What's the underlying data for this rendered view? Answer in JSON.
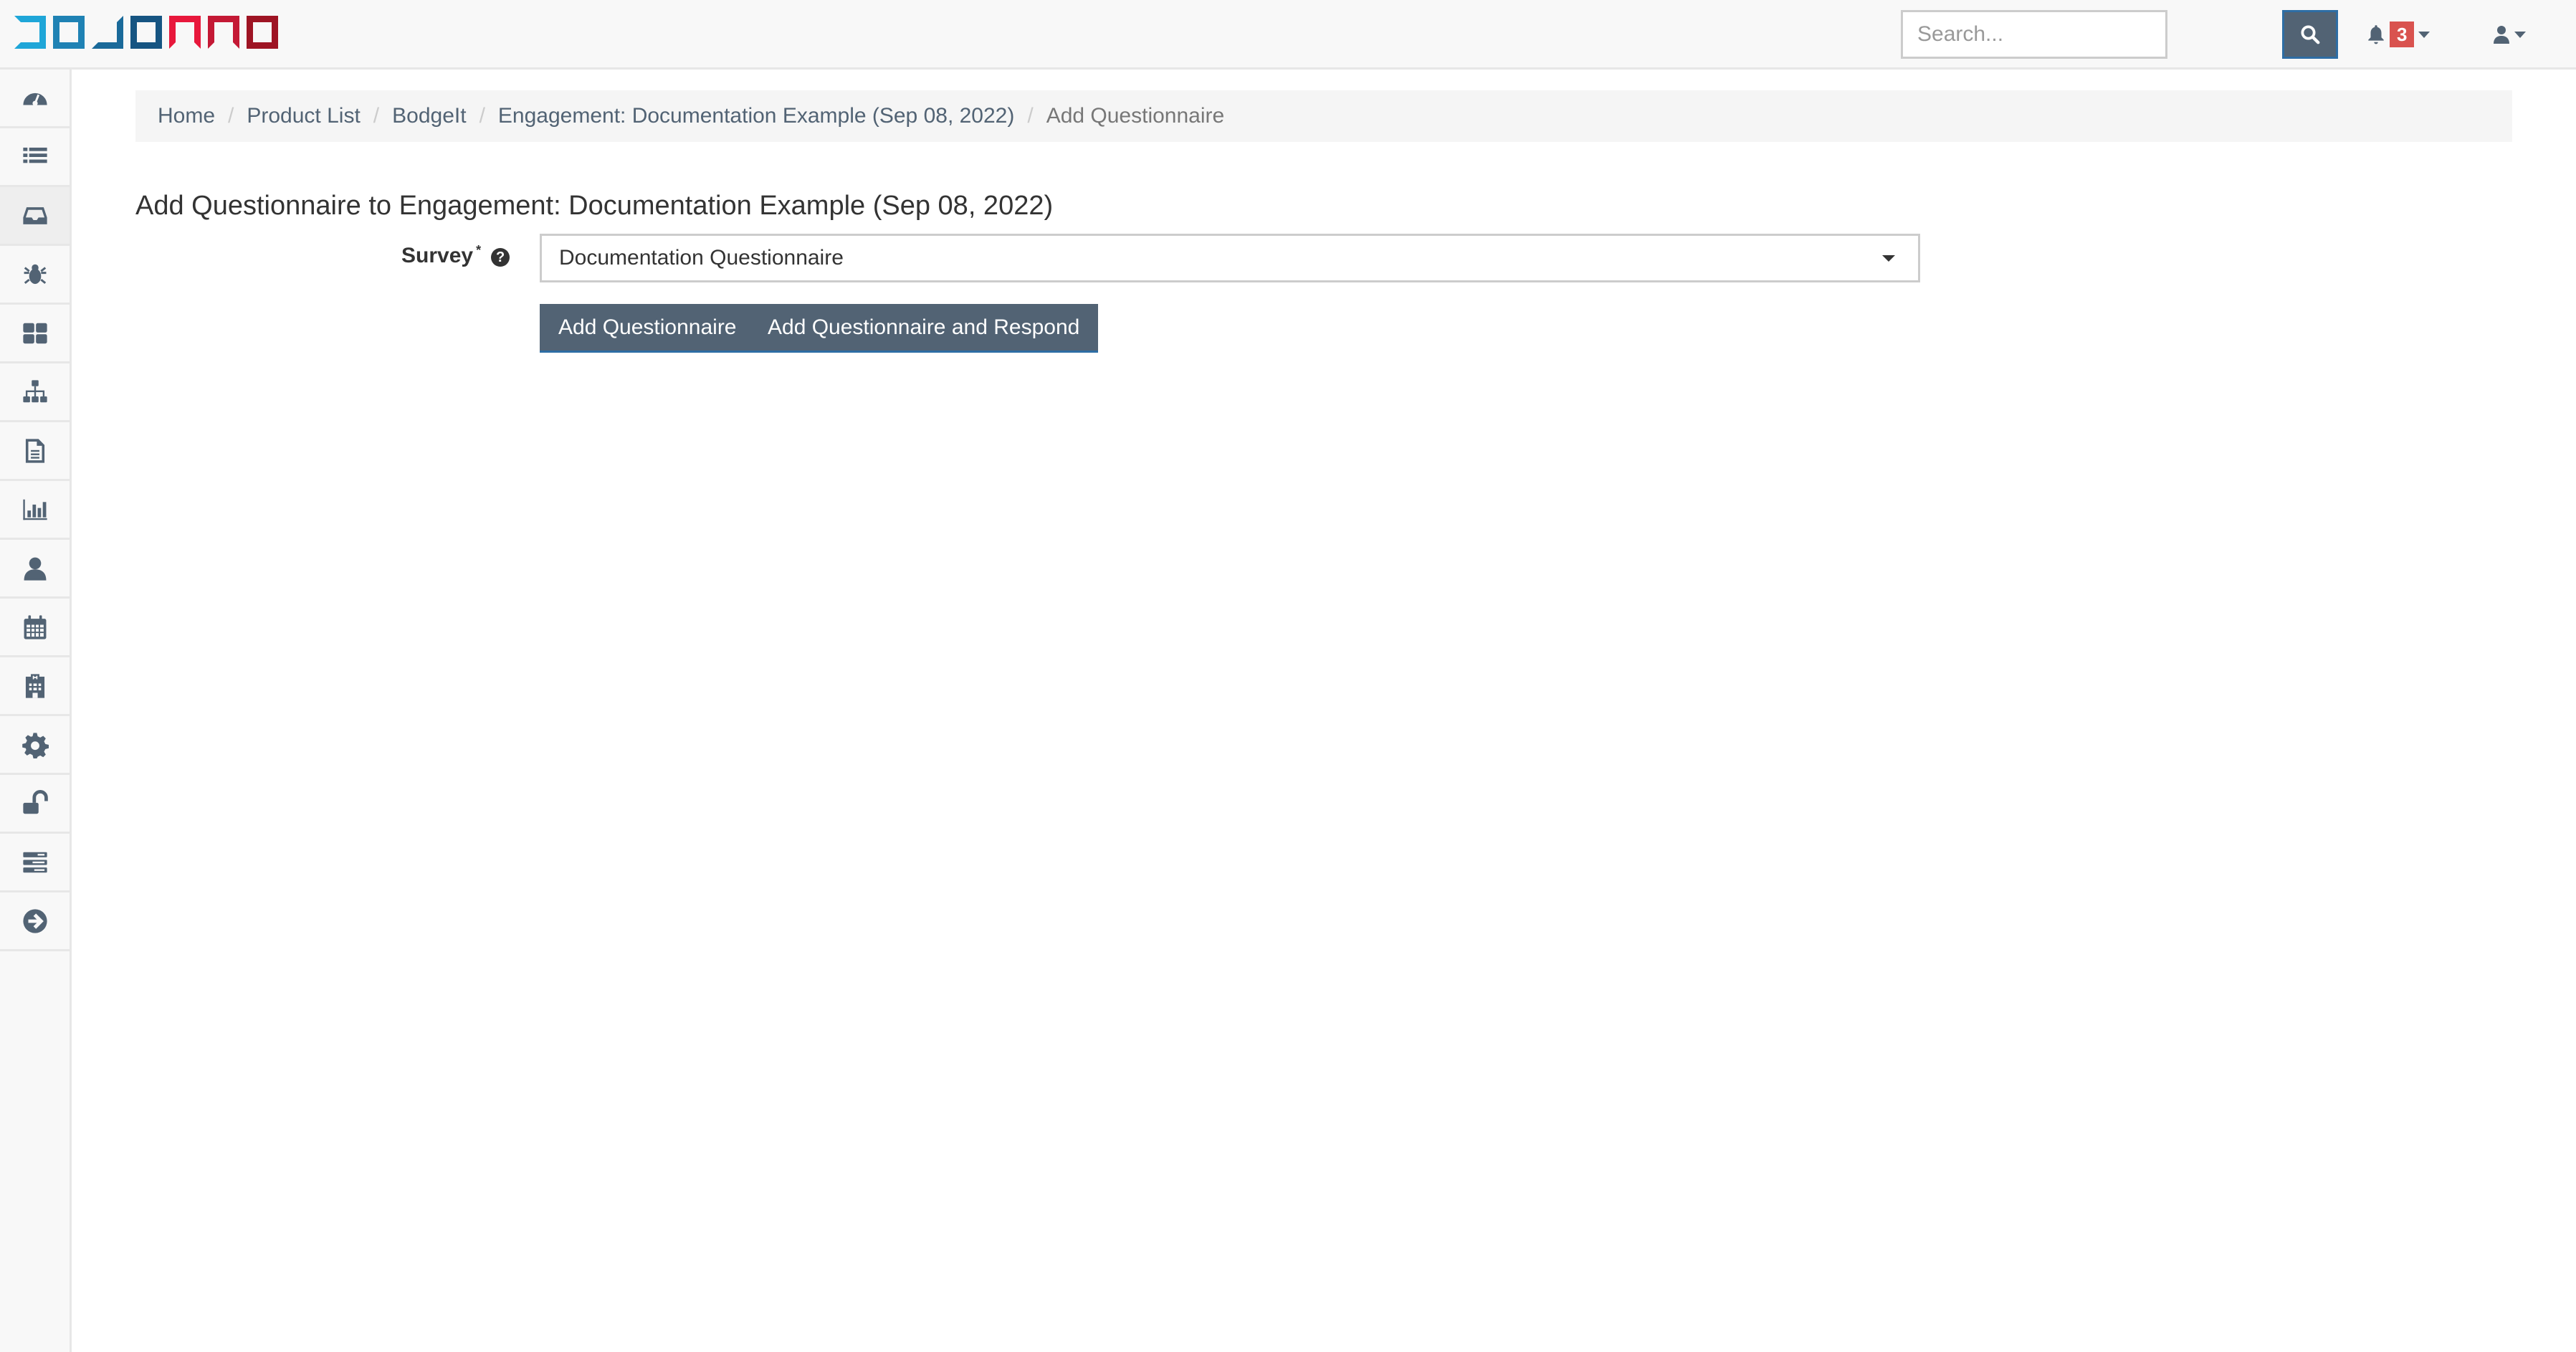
{
  "app": {
    "logo_text": "DOJO PRO"
  },
  "topbar": {
    "search_placeholder": "Search...",
    "search_value": "",
    "notification_count": "3",
    "icons": {
      "search": "search-icon",
      "notifications": "bell-icon",
      "user": "user-icon"
    }
  },
  "sidebar": {
    "items": [
      {
        "icon": "dashboard-icon",
        "active": false
      },
      {
        "icon": "list-icon",
        "active": false
      },
      {
        "icon": "inbox-icon",
        "active": true
      },
      {
        "icon": "bug-icon",
        "active": false
      },
      {
        "icon": "grid-icon",
        "active": false
      },
      {
        "icon": "sitemap-icon",
        "active": false
      },
      {
        "icon": "document-icon",
        "active": false
      },
      {
        "icon": "bar-chart-icon",
        "active": false
      },
      {
        "icon": "user-icon",
        "active": false
      },
      {
        "icon": "calendar-icon",
        "active": false
      },
      {
        "icon": "building-icon",
        "active": false
      },
      {
        "icon": "gear-icon",
        "active": false
      },
      {
        "icon": "unlock-icon",
        "active": false
      },
      {
        "icon": "server-icon",
        "active": false
      },
      {
        "icon": "arrow-circle-right-icon",
        "active": false
      }
    ]
  },
  "breadcrumb": {
    "items": [
      {
        "label": "Home"
      },
      {
        "label": "Product List"
      },
      {
        "label": "BodgeIt"
      },
      {
        "label": "Engagement: Documentation Example (Sep 08, 2022)"
      },
      {
        "label": "Add Questionnaire"
      }
    ]
  },
  "page": {
    "title": "Add Questionnaire to Engagement: Documentation Example (Sep 08, 2022)"
  },
  "form": {
    "survey_label": "Survey",
    "required_marker": "*",
    "help_glyph": "?",
    "survey_selected": "Documentation Questionnaire",
    "buttons": {
      "add": "Add Questionnaire",
      "add_respond": "Add Questionnaire and Respond"
    }
  }
}
